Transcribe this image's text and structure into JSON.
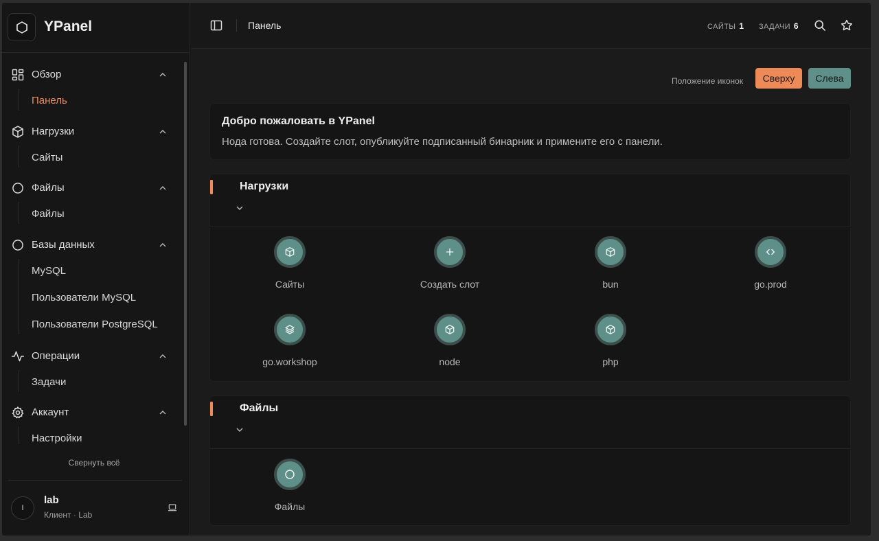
{
  "app": {
    "name": "YPanel",
    "logo_icon": "hexagon-icon"
  },
  "sidebar": {
    "groups": [
      {
        "label": "Обзор",
        "icon": "grid-icon",
        "items": [
          {
            "label": "Панель",
            "active": true
          }
        ]
      },
      {
        "label": "Нагрузки",
        "icon": "box-icon",
        "items": [
          {
            "label": "Сайты"
          }
        ]
      },
      {
        "label": "Файлы",
        "icon": "circle-icon",
        "items": [
          {
            "label": "Файлы"
          }
        ]
      },
      {
        "label": "Базы данных",
        "icon": "circle-icon",
        "items": [
          {
            "label": "MySQL"
          },
          {
            "label": "Пользователи MySQL"
          },
          {
            "label": "Пользователи PostgreSQL"
          }
        ]
      },
      {
        "label": "Операции",
        "icon": "activity-icon",
        "items": [
          {
            "label": "Задачи"
          }
        ]
      },
      {
        "label": "Аккаунт",
        "icon": "gear-icon",
        "items": [
          {
            "label": "Настройки"
          }
        ]
      }
    ],
    "collapse_all": "Свернуть всё",
    "user": {
      "avatar": "I",
      "name": "lab",
      "role": "Клиент",
      "separator": "·",
      "org": "Lab"
    }
  },
  "topbar": {
    "breadcrumb": "Панель",
    "stats": [
      {
        "label": "САЙТЫ",
        "value": "1"
      },
      {
        "label": "ЗАДАЧИ",
        "value": "6"
      }
    ]
  },
  "main": {
    "icon_position_label": "Положение иконок",
    "icon_position_options": [
      "Сверху",
      "Слева"
    ],
    "icon_position_selected": "Сверху",
    "welcome": {
      "title": "Добро пожаловать в YPanel",
      "text": "Нода готова. Создайте слот, опубликуйте подписанный бинарник и примените его с панели."
    },
    "sections": [
      {
        "title": "Нагрузки",
        "tiles": [
          {
            "label": "Сайты",
            "icon": "box-icon"
          },
          {
            "label": "Создать слот",
            "icon": "plus-icon"
          },
          {
            "label": "bun",
            "icon": "box-icon"
          },
          {
            "label": "go.prod",
            "icon": "code-icon"
          },
          {
            "label": "go.workshop",
            "icon": "layers-icon"
          },
          {
            "label": "node",
            "icon": "box-icon"
          },
          {
            "label": "php",
            "icon": "box-icon"
          }
        ]
      },
      {
        "title": "Файлы",
        "tiles": [
          {
            "label": "Файлы",
            "icon": "circle-icon"
          }
        ]
      }
    ]
  },
  "colors": {
    "accent": "#ee8958",
    "teal": "#5e8f89",
    "background": "#181818"
  }
}
